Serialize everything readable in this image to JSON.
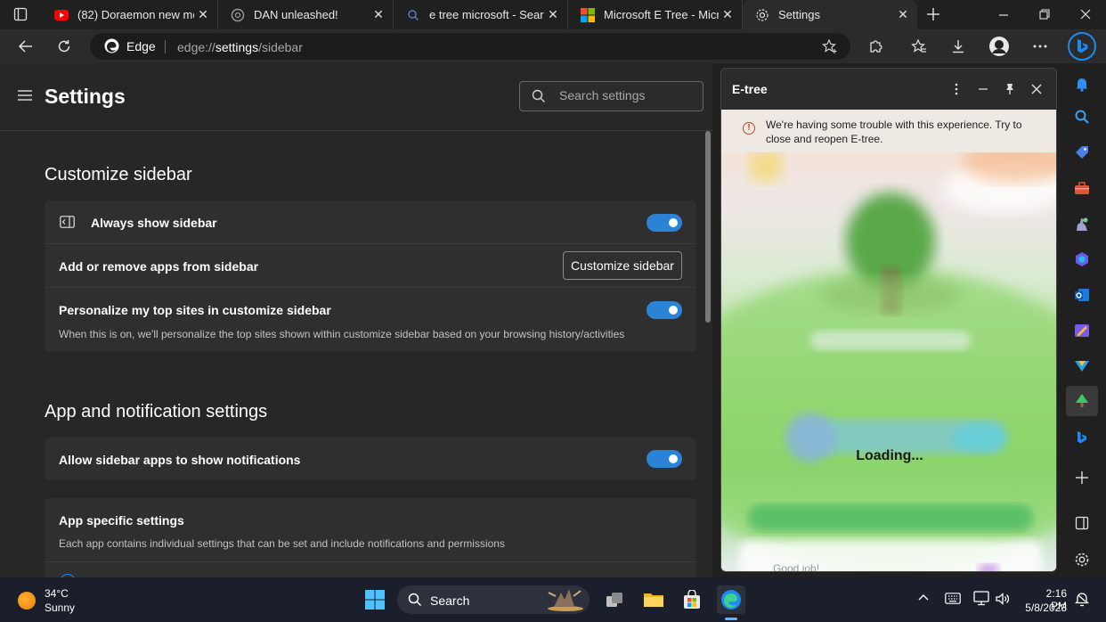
{
  "tabs": [
    {
      "label": "(82) Doraemon new mov",
      "icon": "youtube-icon"
    },
    {
      "label": "DAN unleashed!",
      "icon": "openai-icon"
    },
    {
      "label": "e tree microsoft - Search",
      "icon": "search-icon"
    },
    {
      "label": "Microsoft E Tree - Micros",
      "icon": "microsoft-logo-icon"
    },
    {
      "label": "Settings",
      "icon": "gear-icon",
      "active": true
    }
  ],
  "address_bar": {
    "browser_label": "Edge",
    "url_scheme": "edge://",
    "url_host": "settings",
    "url_path": "/sidebar"
  },
  "settings": {
    "title": "Settings",
    "search_placeholder": "Search settings",
    "sections": {
      "customize": {
        "title": "Customize sidebar",
        "always_show": {
          "label": "Always show sidebar",
          "enabled": true
        },
        "add_remove": {
          "label": "Add or remove apps from sidebar",
          "button": "Customize sidebar"
        },
        "personalize": {
          "label": "Personalize my top sites in customize sidebar",
          "description": "When this is on, we'll personalize the top sites shown within customize sidebar based on your browsing history/activities",
          "enabled": true
        }
      },
      "notifications": {
        "title": "App and notification settings",
        "allow": {
          "label": "Allow sidebar apps to show notifications",
          "enabled": true
        },
        "app_specific": {
          "label": "App specific settings",
          "description": "Each app contains individual settings that can be set and include notifications and permissions"
        }
      }
    }
  },
  "pane": {
    "title": "E-tree",
    "warning": "We're having some trouble with this experience. Try to close and reopen E-tree.",
    "loading": "Loading...",
    "footer": "Good job!"
  },
  "sidebar_icons": [
    "bell-icon",
    "search-icon",
    "tag-icon",
    "toolbox-icon",
    "games-icon",
    "office-icon",
    "outlook-icon",
    "designer-icon",
    "send-icon",
    "etree-icon",
    "bing-icon",
    "add-icon",
    "split-screen-icon",
    "settings-icon"
  ],
  "taskbar": {
    "temperature": "34°C",
    "condition": "Sunny",
    "search_label": "Search",
    "time": "2:16 PM",
    "date": "5/8/2023"
  },
  "colors": {
    "accent": "#2b83d6",
    "warning": "#c0492c",
    "bing": "#1c8bf0"
  }
}
